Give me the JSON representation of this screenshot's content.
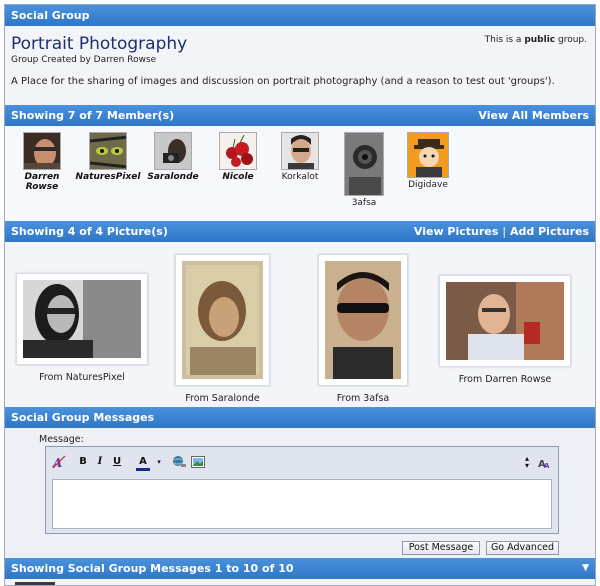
{
  "header": {
    "title": "Social Group"
  },
  "group": {
    "name": "Portrait Photography",
    "creator": "Group Created by Darren Rowse",
    "public_prefix": "This is a",
    "public_word": "public",
    "public_suffix": "group.",
    "description": "A Place for the sharing of images and discussion on portrait photography (and a reason to test out 'groups')."
  },
  "members": {
    "heading": "Showing 7 of 7 Member(s)",
    "view_all": "View All Members",
    "items": [
      {
        "name": "Darren Rowse"
      },
      {
        "name": "NaturesPixel"
      },
      {
        "name": "Saralonde"
      },
      {
        "name": "Nicole"
      },
      {
        "name": "Korkalot"
      },
      {
        "name": "3afsa"
      },
      {
        "name": "Digidave"
      }
    ]
  },
  "pictures": {
    "heading": "Showing 4 of 4 Picture(s)",
    "view": "View Pictures",
    "separator": "|",
    "add": "Add Pictures",
    "items": [
      {
        "caption": "From NaturesPixel"
      },
      {
        "caption": "From Saralonde"
      },
      {
        "caption": "From 3afsa"
      },
      {
        "caption": "From Darren Rowse"
      }
    ]
  },
  "messages": {
    "heading": "Social Group Messages",
    "label": "Message:",
    "post_button": "Post Message",
    "advanced_button": "Go Advanced",
    "toolbar": {
      "bold": "B",
      "italic": "I",
      "underline": "U",
      "font_color": "A"
    }
  },
  "listing": {
    "heading": "Showing Social Group Messages 1 to 10 of 10"
  },
  "colors": {
    "bar": "#2f76c8",
    "panel": "#eef0f6",
    "title": "#1d2f6b"
  }
}
